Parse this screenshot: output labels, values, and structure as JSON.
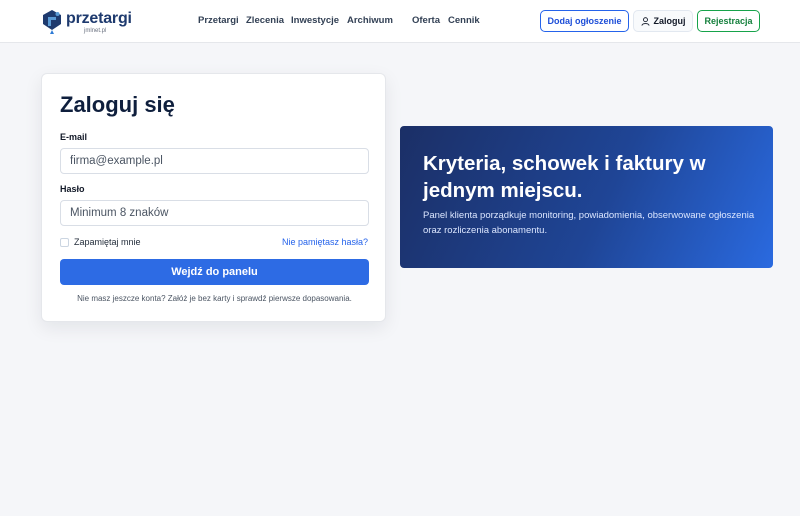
{
  "header": {
    "logo_text": "przetargi",
    "logo_sub": "jmlnet.pl",
    "nav": [
      "Przetargi",
      "Zlecenia",
      "Inwestycje",
      "Archiwum",
      "Oferta",
      "Cennik"
    ],
    "add_listing": "Dodaj ogłoszenie",
    "login": "Zaloguj",
    "register": "Rejestracja"
  },
  "login_form": {
    "title": "Zaloguj się",
    "email_label": "E-mail",
    "email_placeholder": "firma@example.pl",
    "password_label": "Hasło",
    "password_placeholder": "Minimum 8 znaków",
    "remember_label": "Zapamiętaj mnie",
    "forgot_link": "Nie pamiętasz hasła?",
    "submit_label": "Wejdź do panelu",
    "signup_note": "Nie masz jeszcze konta? Załóż je bez karty i sprawdź pierwsze dopasowania."
  },
  "hero": {
    "heading": "Kryteria, schowek i faktury w jednym miejscu.",
    "text": "Panel klienta porządkuje monitoring, powiadomienia, obserwowane ogłoszenia oraz rozliczenia abonamentu."
  },
  "colors": {
    "primary": "#2d6be4",
    "brand": "#1e3a6e",
    "register": "#16a34a",
    "hero_start": "#1b2f66",
    "hero_end": "#2a6ae0"
  }
}
